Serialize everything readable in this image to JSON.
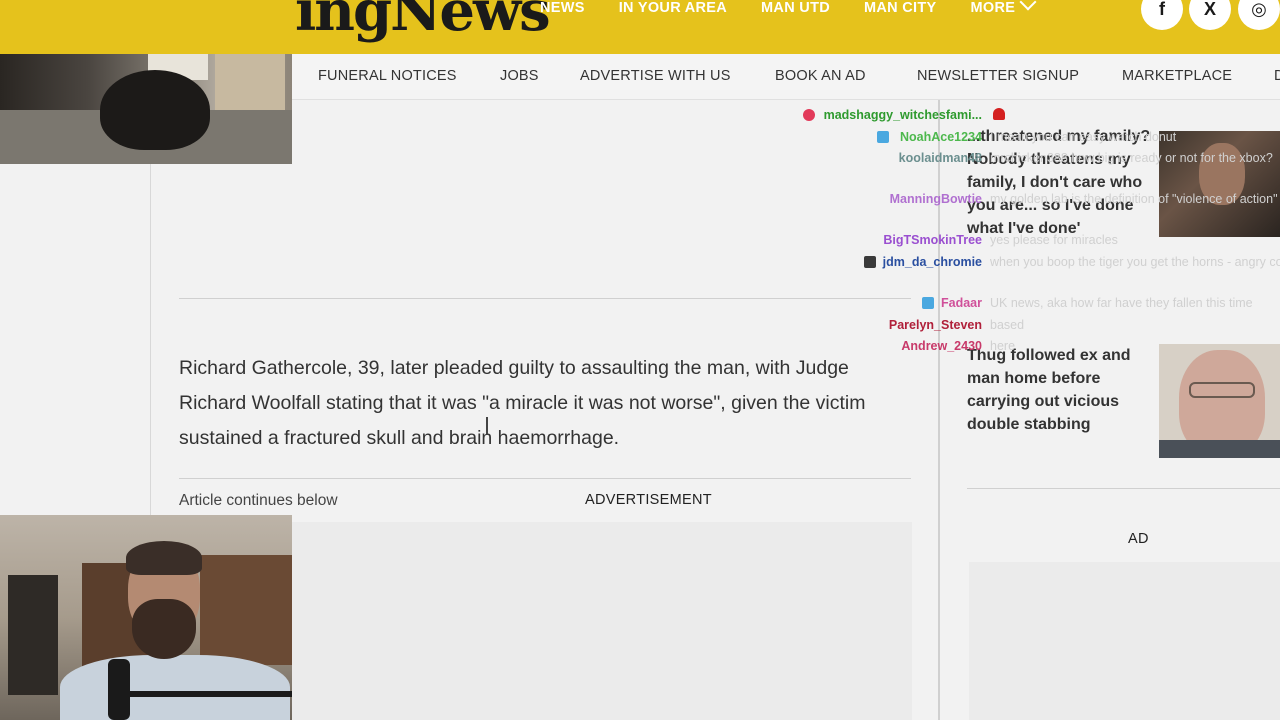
{
  "header": {
    "logo_text": "ingNews",
    "nav": [
      "NEWS",
      "IN YOUR AREA",
      "MAN UTD",
      "MAN CITY",
      "MORE"
    ],
    "social_icons": [
      "facebook-icon",
      "x-icon",
      "instagram-icon"
    ],
    "social_glyphs": [
      "f",
      "X",
      "◎"
    ]
  },
  "subnav": [
    "FUNERAL NOTICES",
    "JOBS",
    "ADVERTISE WITH US",
    "BOOK AN AD",
    "NEWSLETTER SIGNUP",
    "MARKETPLACE",
    "D"
  ],
  "article": {
    "paragraph": "Richard Gathercole, 39, later pleaded guilty to assaulting the man, with Judge Richard Woolfall stating that it was \"a miracle it was not worse\", given the victim sustained a fractured skull and brain haemorrhage.",
    "continues_label": "Article continues below",
    "ad_label": "ADVERTISEMENT"
  },
  "sidebar": {
    "story1_headline": "...threatened my family? Nobody threatens my family, I don't care who you are... so I've done what I've done'",
    "story2_headline": "Thug followed ex and man home before carrying out vicious double stabbing",
    "ad_label": "AD"
  },
  "chat": [
    {
      "name": "madshaggy_witchesfami...",
      "message": "",
      "color": "#2e9a2e"
    },
    {
      "name": "NoahAce1234",
      "message": "I mean you can easy watch donut",
      "color": "#4db84d"
    },
    {
      "name": "koolaidman48",
      "message": "mrchicken388 how big is ready or not for the xbox?",
      "color": "#6b8f8f"
    },
    {
      "name": "ManningBowtie",
      "message": "my golden lab is the definition of \"violence of action\"",
      "color": "#b070d0"
    },
    {
      "name": "BigTSmokinTree",
      "message": "yes please for miracles",
      "color": "#9a4fd0"
    },
    {
      "name": "jdm_da_chromie",
      "message": "when you boop the tiger you get the horns - angry cop",
      "color": "#2a4fa0"
    },
    {
      "name": "Fadaar",
      "message": "UK news, aka how far have they fallen this time",
      "color": "#d0509a"
    },
    {
      "name": "Parelyn_Steven",
      "message": "based",
      "color": "#b0203a"
    },
    {
      "name": "Andrew_2430",
      "message": "here",
      "color": "#c83a6a"
    }
  ],
  "colors": {
    "brand_yellow": "#e5c21c",
    "page_bg": "#f2f2f2"
  }
}
